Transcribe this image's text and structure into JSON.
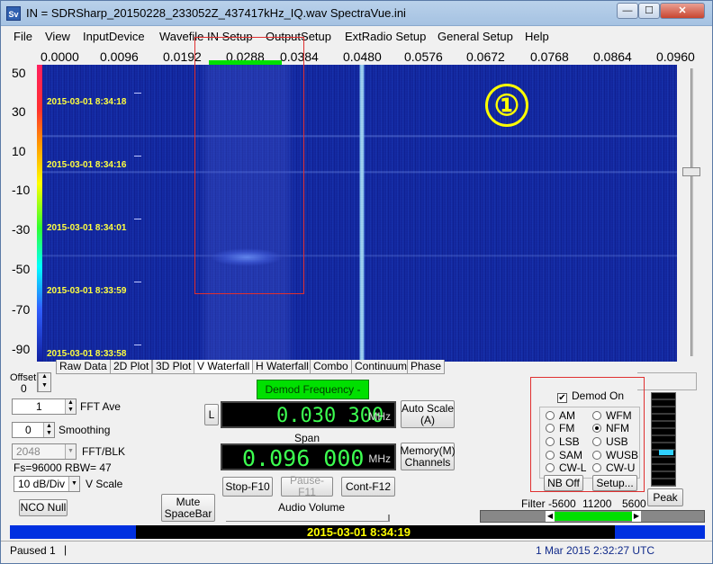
{
  "window": {
    "title": "IN = SDRSharp_20150228_233052Z_437417kHz_IQ.wav    SpectraVue.ini",
    "icon_label": "Sv",
    "controls": {
      "minimize": "—",
      "maximize": "☐",
      "close": "✕"
    }
  },
  "menu": [
    "File",
    "View",
    "InputDevice",
    "Wavefile IN Setup",
    "OutputSetup",
    "ExtRadio Setup",
    "General Setup",
    "Help"
  ],
  "freq_axis": [
    "0.0000",
    "0.0096",
    "0.0192",
    "0.0288",
    "0.0384",
    "0.0480",
    "0.0576",
    "0.0672",
    "0.0768",
    "0.0864",
    "0.0960"
  ],
  "db_axis": [
    "50",
    "30",
    "10",
    "-10",
    "-30",
    "-50",
    "-70",
    "-90"
  ],
  "timestamps": [
    "2015-03-01 8:34:18",
    "2015-03-01 8:34:16",
    "2015-03-01 8:34:01",
    "2015-03-01 8:33:59",
    "2015-03-01 8:33:58"
  ],
  "marker_label": "①",
  "tabs": [
    "Raw Data",
    "2D Plot",
    "3D Plot",
    "V Waterfall",
    "H Waterfall",
    "Combo",
    "Continuum",
    "Phase"
  ],
  "active_tab": "V Waterfall",
  "left_controls": {
    "offset_label": "Offset",
    "offset_value": "0",
    "fft_ave_value": "1",
    "fft_ave_label": "FFT Ave",
    "smoothing_value": "0",
    "smoothing_label": "Smoothing",
    "fft_blk_value": "2048",
    "fft_blk_label": "FFT/BLK",
    "fs_text": "Fs=96000 RBW=  47",
    "vscale_value": "10 dB/Div",
    "vscale_label": "V Scale",
    "nco_null": "NCO Null"
  },
  "center_controls": {
    "demod_freq_btn": "Demod Frequency - Ins",
    "l_btn": "L",
    "demod_freq": "0.030 300",
    "demod_unit": "MHz",
    "auto_scale": "Auto Scale\n(A)",
    "span_label": "Span",
    "span_value": "0.096 000",
    "span_unit": "MHz",
    "memory": "Memory(M)\nChannels",
    "mute": "Mute\nSpaceBar",
    "stop": "Stop-F10",
    "pause": "Pause-F11",
    "cont": "Cont-F12",
    "audio_volume": "Audio Volume"
  },
  "demod_panel": {
    "demod_on_label": "Demod On",
    "demod_on_checked": "✔",
    "modes_left": [
      "AM",
      "FM",
      "LSB",
      "SAM",
      "CW-L"
    ],
    "modes_right": [
      "WFM",
      "NFM",
      "USB",
      "WUSB",
      "CW-U"
    ],
    "selected_mode": "NFM",
    "nb_off": "NB Off",
    "setup": "Setup..."
  },
  "peak_label": "Peak",
  "filter": {
    "label": "Filter",
    "low": "-5600",
    "bw": "11200",
    "high": "5600"
  },
  "time_bar": "2015-03-01 8:34:19",
  "status": {
    "left": "Paused 1",
    "right": "1 Mar 2015  2:32:27 UTC"
  }
}
